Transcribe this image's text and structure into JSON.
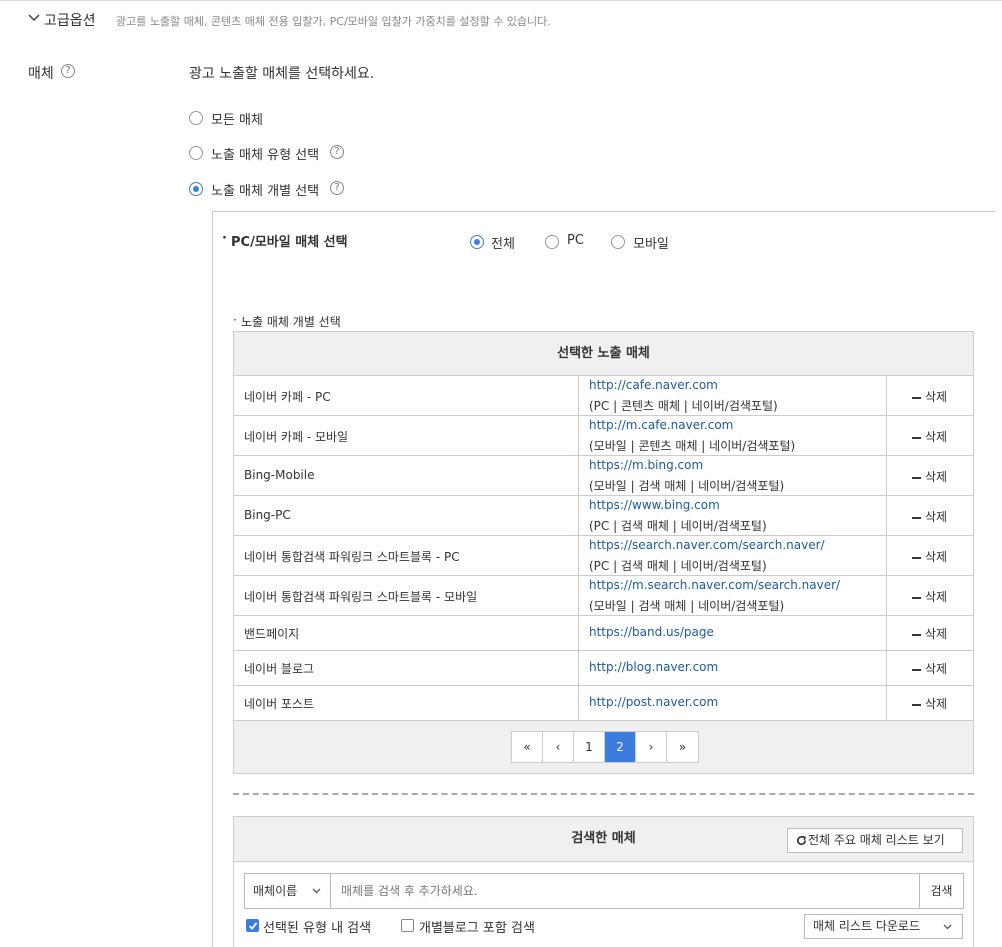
{
  "advanced": {
    "title": "고급옵션",
    "description": "광고를 노출할 매체, 콘텐츠 매체 전용 입찰가, PC/모바일 입찰가 가중치를 설정할 수 있습니다."
  },
  "media": {
    "label": "매체",
    "instruction": "광고 노출할 매체를 선택하세요.",
    "options": [
      "모든 매체",
      "노출 매체 유형 선택",
      "노출 매체 개별 선택"
    ],
    "selected_option": "노출 매체 개별 선택"
  },
  "device": {
    "title": "PC/모바일 매체 선택",
    "options": [
      "전체",
      "PC",
      "모바일"
    ],
    "selected": "전체"
  },
  "individual": {
    "title": "노출 매체 개별 선택",
    "table_header": "선택한 노출 매체",
    "delete_label": "삭제",
    "rows": [
      {
        "name": "네이버 카페 - PC",
        "url": "http://cafe.naver.com",
        "detail": "(PC | 콘텐츠 매체 | 네이버/검색포털)"
      },
      {
        "name": "네이버 카페 - 모바일",
        "url": "http://m.cafe.naver.com",
        "detail": "(모바일 | 콘텐츠 매체 | 네이버/검색포털)"
      },
      {
        "name": "Bing-Mobile",
        "url": "https://m.bing.com",
        "detail": "(모바일 | 검색 매체 | 네이버/검색포털)"
      },
      {
        "name": "Bing-PC",
        "url": "https://www.bing.com",
        "detail": "(PC | 검색 매체 | 네이버/검색포털)"
      },
      {
        "name": "네이버 통합검색 파워링크 스마트블록 - PC",
        "url": "https://search.naver.com/search.naver/",
        "detail": "(PC | 검색 매체 | 네이버/검색포털)"
      },
      {
        "name": "네이버 통합검색 파워링크 스마트블록 - 모바일",
        "url": "https://m.search.naver.com/search.naver/",
        "detail": "(모바일 | 검색 매체 | 네이버/검색포털)"
      },
      {
        "name": "밴드페이지",
        "url": "https://band.us/page",
        "detail": ""
      },
      {
        "name": "네이버 블로그",
        "url": "http://blog.naver.com",
        "detail": ""
      },
      {
        "name": "네이버 포스트",
        "url": "http://post.naver.com",
        "detail": ""
      }
    ],
    "pagination": {
      "first": "«",
      "prev": "‹",
      "pages": [
        "1",
        "2"
      ],
      "current": "2",
      "next": "›",
      "last": "»"
    }
  },
  "searched": {
    "title": "검색한 매체",
    "view_all_label": "전체 주요 매체 리스트 보기",
    "select_value": "매체이름",
    "input_placeholder": "매체를 검색 후 추가하세요.",
    "search_button": "검색",
    "checkbox1": "선택된 유형 내 검색",
    "checkbox1_checked": true,
    "checkbox2": "개별블로그 포함 검색",
    "checkbox2_checked": false,
    "download_label": "매체 리스트 다운로드"
  },
  "colors": {
    "accent": "#3b7ddd",
    "link": "#1a5c9e"
  }
}
